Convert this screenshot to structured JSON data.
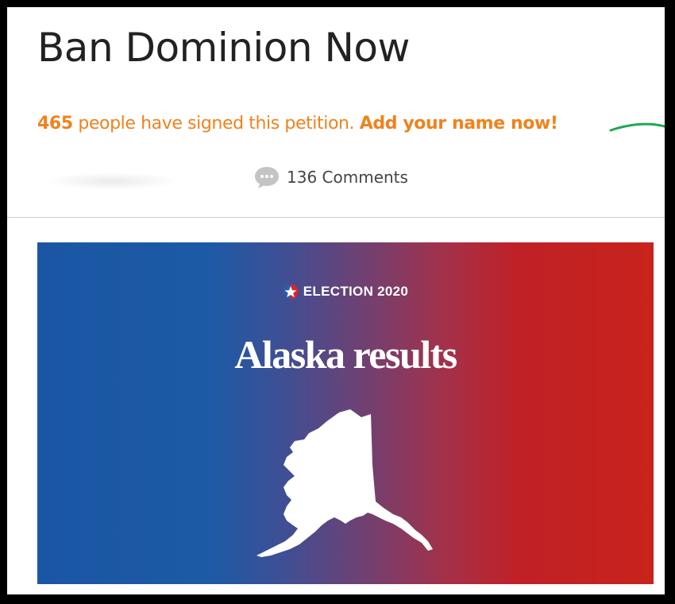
{
  "petition": {
    "title": "Ban Dominion Now",
    "signature_count": "465",
    "signed_text": " people have signed this petition. ",
    "cta": "Add your name now!",
    "accent_color": "#f0821e"
  },
  "comments": {
    "icon": "speech-bubble-icon",
    "label": "136 Comments"
  },
  "banner": {
    "badge_icon": "star-badge-icon",
    "tag": "ELECTION 2020",
    "title": "Alaska results",
    "map_icon": "alaska-map-icon",
    "gradient_left": "#1a56a3",
    "gradient_right": "#c8231c"
  }
}
